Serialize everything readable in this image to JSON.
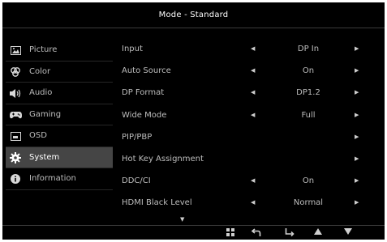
{
  "header": {
    "title": "Mode - Standard"
  },
  "sidebar": {
    "items": [
      {
        "label": "Picture",
        "icon": "picture-icon",
        "active": false
      },
      {
        "label": "Color",
        "icon": "color-icon",
        "active": false
      },
      {
        "label": "Audio",
        "icon": "audio-icon",
        "active": false
      },
      {
        "label": "Gaming",
        "icon": "gamepad-icon",
        "active": false
      },
      {
        "label": "OSD",
        "icon": "osd-icon",
        "active": false
      },
      {
        "label": "System",
        "icon": "gear-icon",
        "active": true
      },
      {
        "label": "Information",
        "icon": "info-icon",
        "active": false
      }
    ]
  },
  "settings": {
    "rows": [
      {
        "label": "Input",
        "value": "DP In"
      },
      {
        "label": "Auto Source",
        "value": "On"
      },
      {
        "label": "DP Format",
        "value": "DP1.2"
      },
      {
        "label": "Wide Mode",
        "value": "Full"
      },
      {
        "label": "PIP/PBP",
        "value": ""
      },
      {
        "label": "Hot Key Assignment",
        "value": ""
      },
      {
        "label": "DDC/CI",
        "value": "On"
      },
      {
        "label": "HDMI Black Level",
        "value": "Normal"
      }
    ]
  },
  "bottom_nav": {
    "buttons": [
      {
        "icon": "menu-grid-icon"
      },
      {
        "icon": "back-icon"
      },
      {
        "icon": "enter-icon"
      },
      {
        "icon": "up-icon"
      },
      {
        "icon": "down-icon"
      }
    ]
  }
}
